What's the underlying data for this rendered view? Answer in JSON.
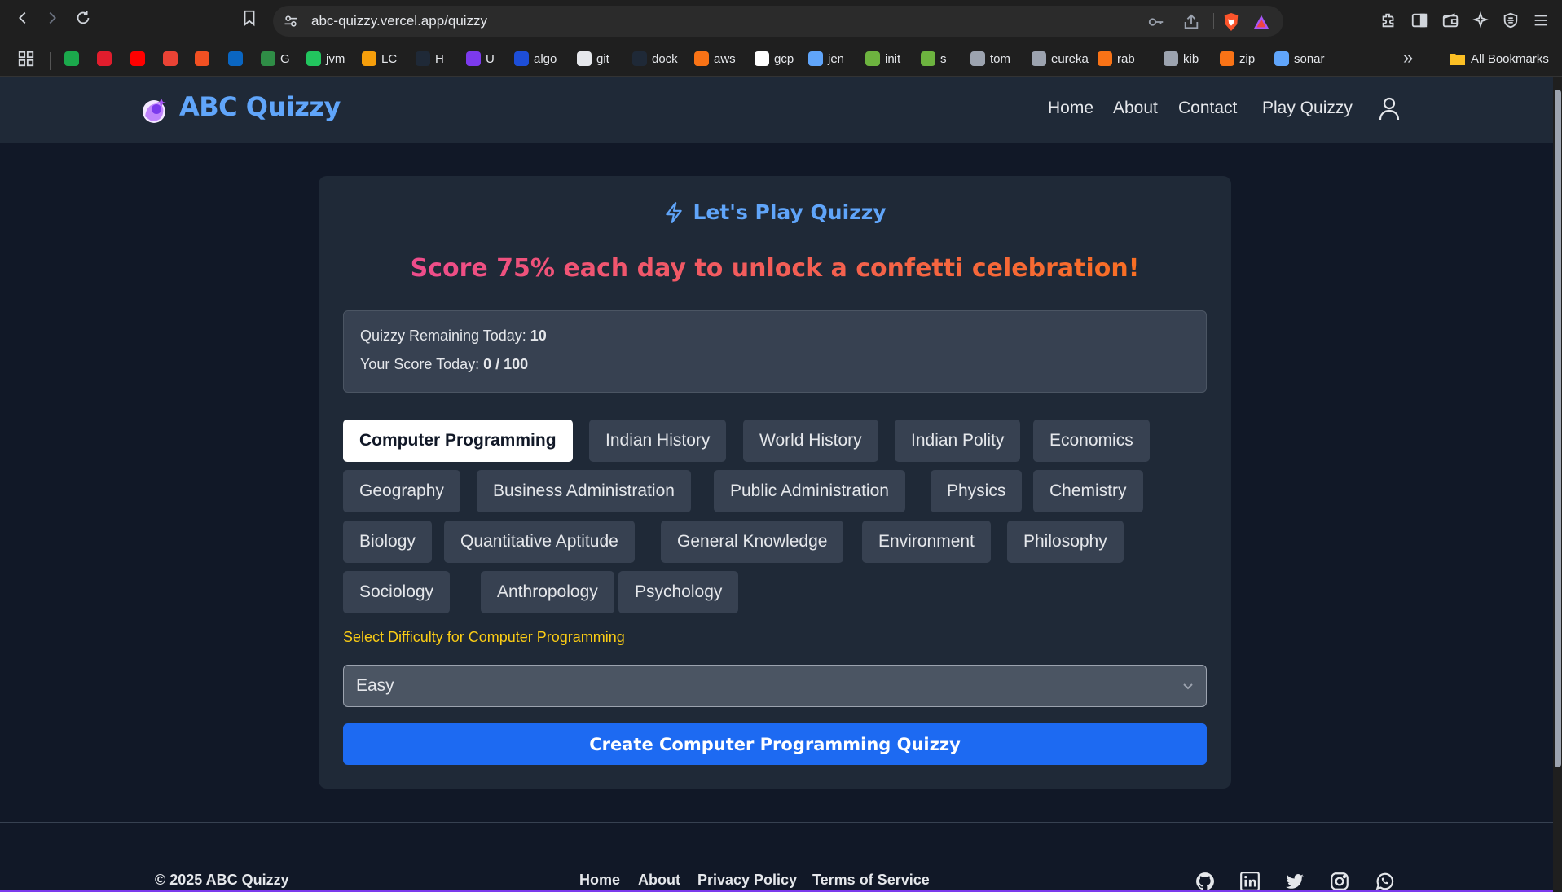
{
  "browser": {
    "url": "abc-quizzy.vercel.app/quizzy",
    "bookmarks": [
      {
        "label": "",
        "icon": "cb-icon",
        "color": "#1ba94c"
      },
      {
        "label": "",
        "icon": "red-diamond-icon",
        "color": "#e11d2d"
      },
      {
        "label": "",
        "icon": "youtube-icon",
        "color": "#ff0000"
      },
      {
        "label": "",
        "icon": "gmail-icon",
        "color": "#ea4335"
      },
      {
        "label": "",
        "icon": "microsoft-icon",
        "color": "#f25022"
      },
      {
        "label": "",
        "icon": "linkedin-icon",
        "color": "#0a66c2"
      },
      {
        "label": "G",
        "icon": "gfg-icon",
        "color": "#2f8d46"
      },
      {
        "label": "jvm",
        "icon": "jvm-icon",
        "color": "#22c55e"
      },
      {
        "label": "LC",
        "icon": "leetcode-icon",
        "color": "#f59e0b"
      },
      {
        "label": "H",
        "icon": "hackerrank-icon",
        "color": "#1f2937"
      },
      {
        "label": "U",
        "icon": "u-icon",
        "color": "#7c3aed"
      },
      {
        "label": "algo",
        "icon": "algo-icon",
        "color": "#1d4ed8"
      },
      {
        "label": "git",
        "icon": "github-icon",
        "color": "#e5e7eb"
      },
      {
        "label": "dock",
        "icon": "docker-icon",
        "color": "#1f2937"
      },
      {
        "label": "aws",
        "icon": "aws-icon",
        "color": "#f97316"
      },
      {
        "label": "gcp",
        "icon": "google-icon",
        "color": "#ffffff"
      },
      {
        "label": "jen",
        "icon": "jenkins-icon",
        "color": "#60a5fa"
      },
      {
        "label": "init",
        "icon": "spring-icon",
        "color": "#6db33f"
      },
      {
        "label": "s",
        "icon": "spring-icon",
        "color": "#6db33f"
      },
      {
        "label": "tom",
        "icon": "globe-icon",
        "color": "#9ca3af"
      },
      {
        "label": "eureka",
        "icon": "globe-icon",
        "color": "#9ca3af"
      },
      {
        "label": "rab",
        "icon": "rabbitmq-icon",
        "color": "#f97316"
      },
      {
        "label": "kib",
        "icon": "kibana-icon",
        "color": "#9ca3af"
      },
      {
        "label": "zip",
        "icon": "zipkin-icon",
        "color": "#f97316"
      },
      {
        "label": "sonar",
        "icon": "sonar-icon",
        "color": "#60a5fa"
      }
    ],
    "more_label": "»",
    "all_bookmarks": "All Bookmarks"
  },
  "site": {
    "brand": "ABC Quizzy",
    "nav": [
      "Home",
      "About",
      "Contact",
      "Play Quizzy"
    ]
  },
  "card": {
    "title": "Let's Play Quizzy",
    "banner": "Score 75% each day to unlock a confetti celebration!",
    "remaining_label": "Quizzy Remaining Today:",
    "remaining_value": "10",
    "score_label": "Your Score Today:",
    "score_value": "0 / 100",
    "categories": [
      "Computer Programming",
      "Indian History",
      "World History",
      "Indian Polity",
      "Economics",
      "Geography",
      "Business Administration",
      "Public Administration",
      "Physics",
      "Chemistry",
      "Biology",
      "Quantitative Aptitude",
      "General Knowledge",
      "Environment",
      "Philosophy",
      "Sociology",
      "Anthropology",
      "Psychology"
    ],
    "selected_category": "Computer Programming",
    "difficulty_label": "Select Difficulty for Computer Programming",
    "difficulty_value": "Easy",
    "create_button": "Create Computer Programming Quizzy"
  },
  "footer": {
    "copyright": "© 2025 ABC Quizzy",
    "links": [
      "Home",
      "About",
      "Privacy Policy",
      "Terms of Service"
    ],
    "social": [
      "github-icon",
      "linkedin-icon",
      "twitter-icon",
      "instagram-icon",
      "whatsapp-icon"
    ]
  },
  "colors": {
    "page_bg": "#111827",
    "header_bg": "#1f2937",
    "accent": "#60a5fa",
    "primary_button": "#1d6af2",
    "difficulty_label": "#facc15",
    "banner_gradient": [
      "#ec4899",
      "#f97316"
    ]
  }
}
